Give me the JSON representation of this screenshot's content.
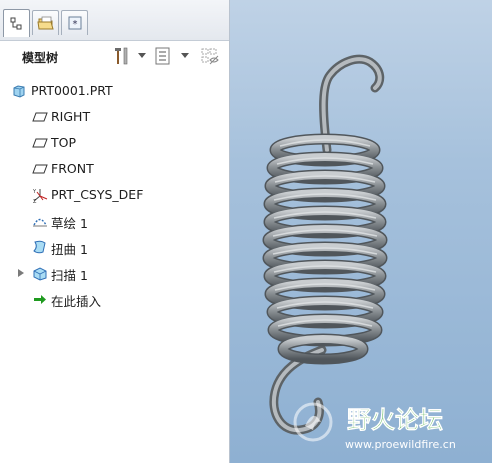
{
  "panel": {
    "tabs": [
      {
        "icon": "model-tree-icon",
        "active": true
      },
      {
        "icon": "folder-browser-icon",
        "active": false
      },
      {
        "icon": "favorites-icon",
        "active": false
      }
    ],
    "title": "模型树",
    "tool_icons": [
      "settings-tools-icon",
      "tree-filter-icon",
      "hide-items-icon"
    ]
  },
  "tree": {
    "root": "PRT0001.PRT",
    "items": [
      {
        "label": "RIGHT",
        "icon": "datum-plane-icon"
      },
      {
        "label": "TOP",
        "icon": "datum-plane-icon"
      },
      {
        "label": "FRONT",
        "icon": "datum-plane-icon"
      },
      {
        "label": "PRT_CSYS_DEF",
        "icon": "coordinate-system-icon"
      },
      {
        "label": "草绘 1",
        "icon": "sketch-icon"
      },
      {
        "label": "扭曲 1",
        "icon": "warp-icon"
      },
      {
        "label": "扫描 1",
        "icon": "sweep-icon"
      },
      {
        "label": "在此插入",
        "icon": "insert-here-arrow-icon"
      }
    ]
  },
  "watermark": {
    "title": "野火论坛",
    "url": "www.proewildfire.cn"
  },
  "colors": {
    "viewport_bg": "#a6c1dc",
    "spring_metal": "#8c9296",
    "watermark_green": "#4cae46",
    "insert_arrow": "#1f9a1f"
  }
}
